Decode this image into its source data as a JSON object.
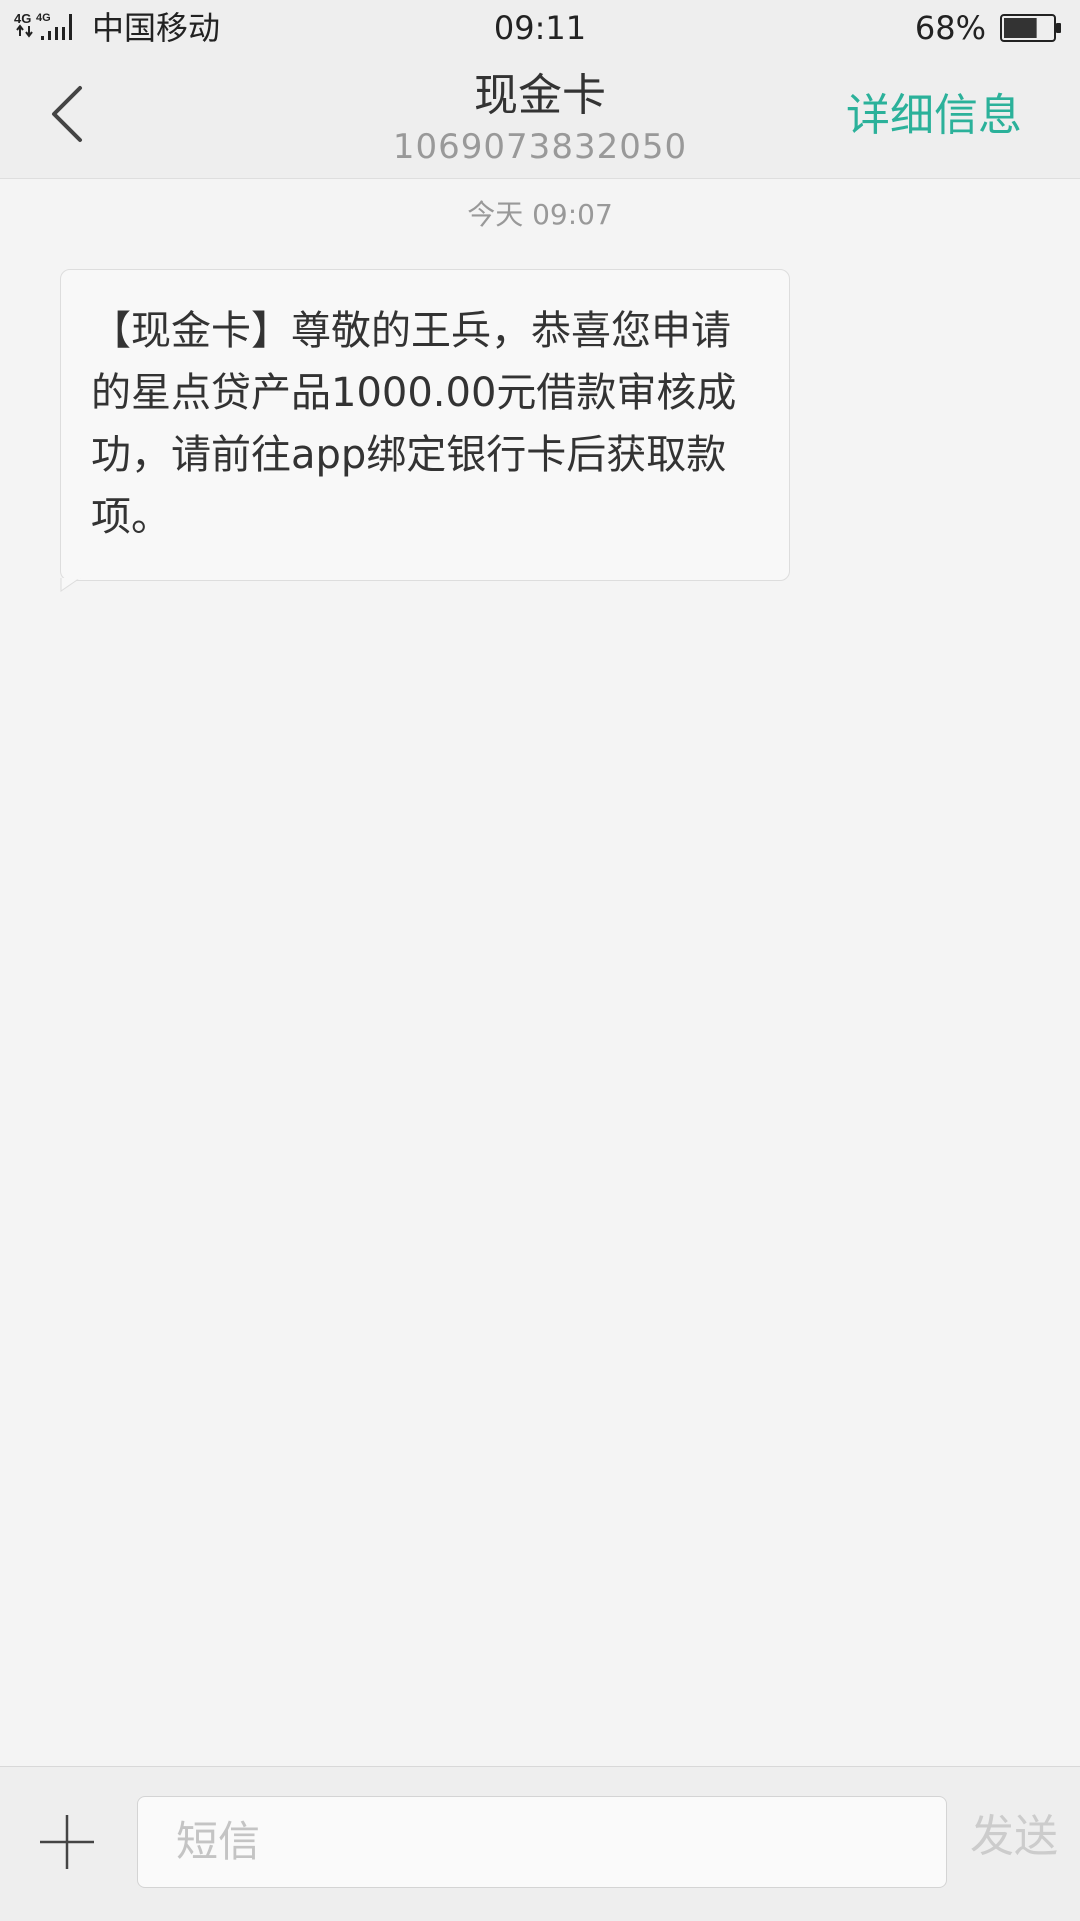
{
  "status_bar": {
    "network_labels": [
      "4G",
      "4G"
    ],
    "carrier": "中国移动",
    "time": "09:11",
    "battery_percent_text": "68%",
    "battery_level": 0.68
  },
  "header": {
    "back_icon": "chevron-left-icon",
    "title": "现金卡",
    "subtitle": "1069073832050",
    "details_label": "详细信息",
    "accent_color": "#2bb19a"
  },
  "conversation": {
    "timestamp": "今天  09:07",
    "messages": [
      {
        "direction": "incoming",
        "text": "【现金卡】尊敬的王兵，恭喜您申请的星点贷产品1000.00元借款审核成功，请前往app绑定银行卡后获取款项。"
      }
    ]
  },
  "composer": {
    "add_icon": "plus-icon",
    "placeholder": "短信",
    "send_label": "发送"
  }
}
